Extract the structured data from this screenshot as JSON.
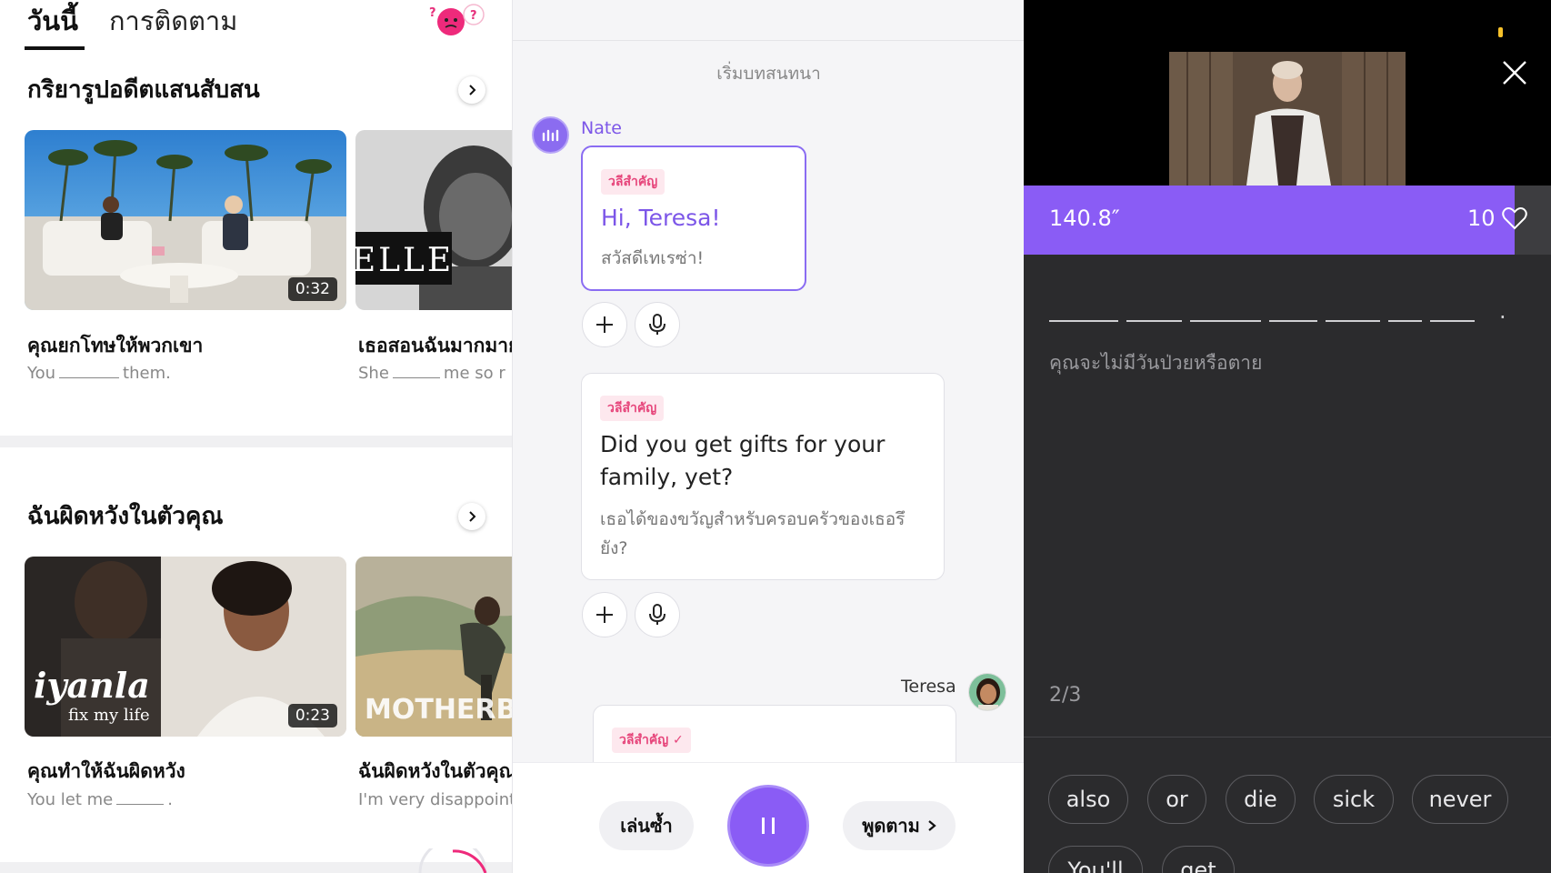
{
  "left": {
    "tabs": {
      "today": "วันนี้",
      "following": "การติดตาม"
    },
    "sections": [
      {
        "title": "กริยารูปอดีตแสนสับสน",
        "cards": [
          {
            "title": "คุณยกโทษให้พวกเขา",
            "sub_before": "You",
            "sub_after": "them.",
            "duration": "0:32"
          },
          {
            "title": "เธอสอนฉันมากมาย",
            "sub_before": "She",
            "sub_after": "me so r",
            "brand": "ELLE"
          }
        ]
      },
      {
        "title": "ฉันผิดหวังในตัวคุณ",
        "cards": [
          {
            "title": "คุณทำให้ฉันผิดหวัง",
            "sub_before": "You let me",
            "sub_after": ".",
            "duration": "0:23",
            "brand": "iyanla",
            "brand_sub": "fix my life"
          },
          {
            "title": "ฉันผิดหวังในตัวคุณ",
            "sub": "I'm very disappoint",
            "brand": "MOTHERB"
          }
        ]
      }
    ]
  },
  "middle": {
    "start_label": "เริ่มบทสนทนา",
    "speaker1": "Nate",
    "speaker2": "Teresa",
    "tag": "วลีสำคัญ",
    "bubbles": [
      {
        "text": "Hi, Teresa!",
        "translation": "สวัสดีเทเรซ่า!"
      },
      {
        "text_line1": "Did you get gifts for your",
        "text_line2": "family, yet?",
        "translation_line1": "เธอได้ของขวัญสำหรับครอบครัวของเธอรึ",
        "translation_line2": "ยัง?"
      }
    ],
    "controls": {
      "replay": "เล่นซ้ำ",
      "speak": "พูดตาม"
    }
  },
  "right": {
    "timer": "140.8″",
    "lives": "10",
    "translation": "คุณจะไม่มีวันป่วยหรือตาย",
    "progress": "2/3",
    "words": [
      "also",
      "or",
      "die",
      "sick",
      "never",
      "You'll",
      "get"
    ],
    "accent": "#8a5cf5"
  }
}
